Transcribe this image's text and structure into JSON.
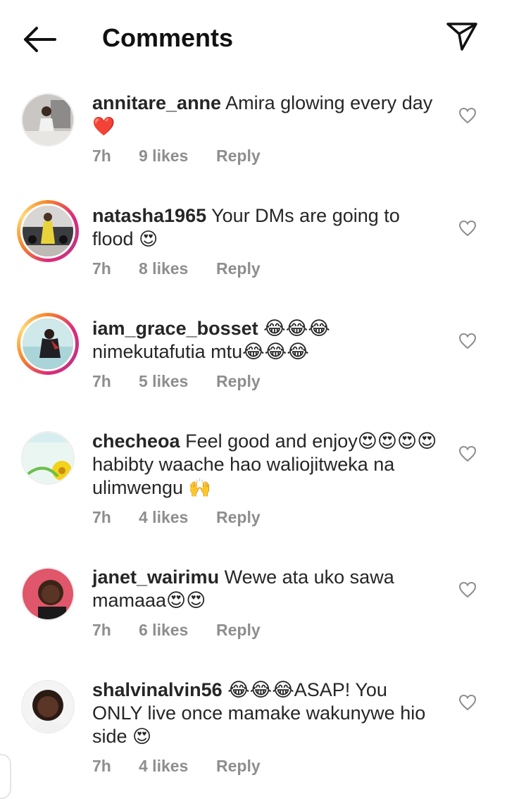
{
  "header": {
    "title": "Comments"
  },
  "comments": [
    {
      "username": "annitare_anne",
      "text": "Amira glowing every day",
      "emoji": "❤️",
      "time": "7h",
      "likes": "9 likes",
      "reply": "Reply"
    },
    {
      "username": "natasha1965",
      "text": "Your DMs are going to flood",
      "emoji": "😍",
      "time": "7h",
      "likes": "8 likes",
      "reply": "Reply"
    },
    {
      "username": "iam_grace_bosset",
      "text": "😂😂😂 nimekutafutia mtu😂😂😂",
      "time": "7h",
      "likes": "5 likes",
      "reply": "Reply"
    },
    {
      "username": "checheoa",
      "text": "Feel good and enjoy😍😍😍😍habibty waache hao waliojitweka na ulimwengu",
      "emoji": "🙌",
      "time": "7h",
      "likes": "4 likes",
      "reply": "Reply"
    },
    {
      "username": "janet_wairimu",
      "text": "Wewe ata uko sawa mamaaa😍😍",
      "time": "7h",
      "likes": "6 likes",
      "reply": "Reply"
    },
    {
      "username": "shalvinalvin56",
      "text": "😂😂😂ASAP! You ONLY live once mamake wakunywe hio side",
      "emoji": "😍",
      "time": "7h",
      "likes": "4 likes",
      "reply": "Reply"
    }
  ]
}
